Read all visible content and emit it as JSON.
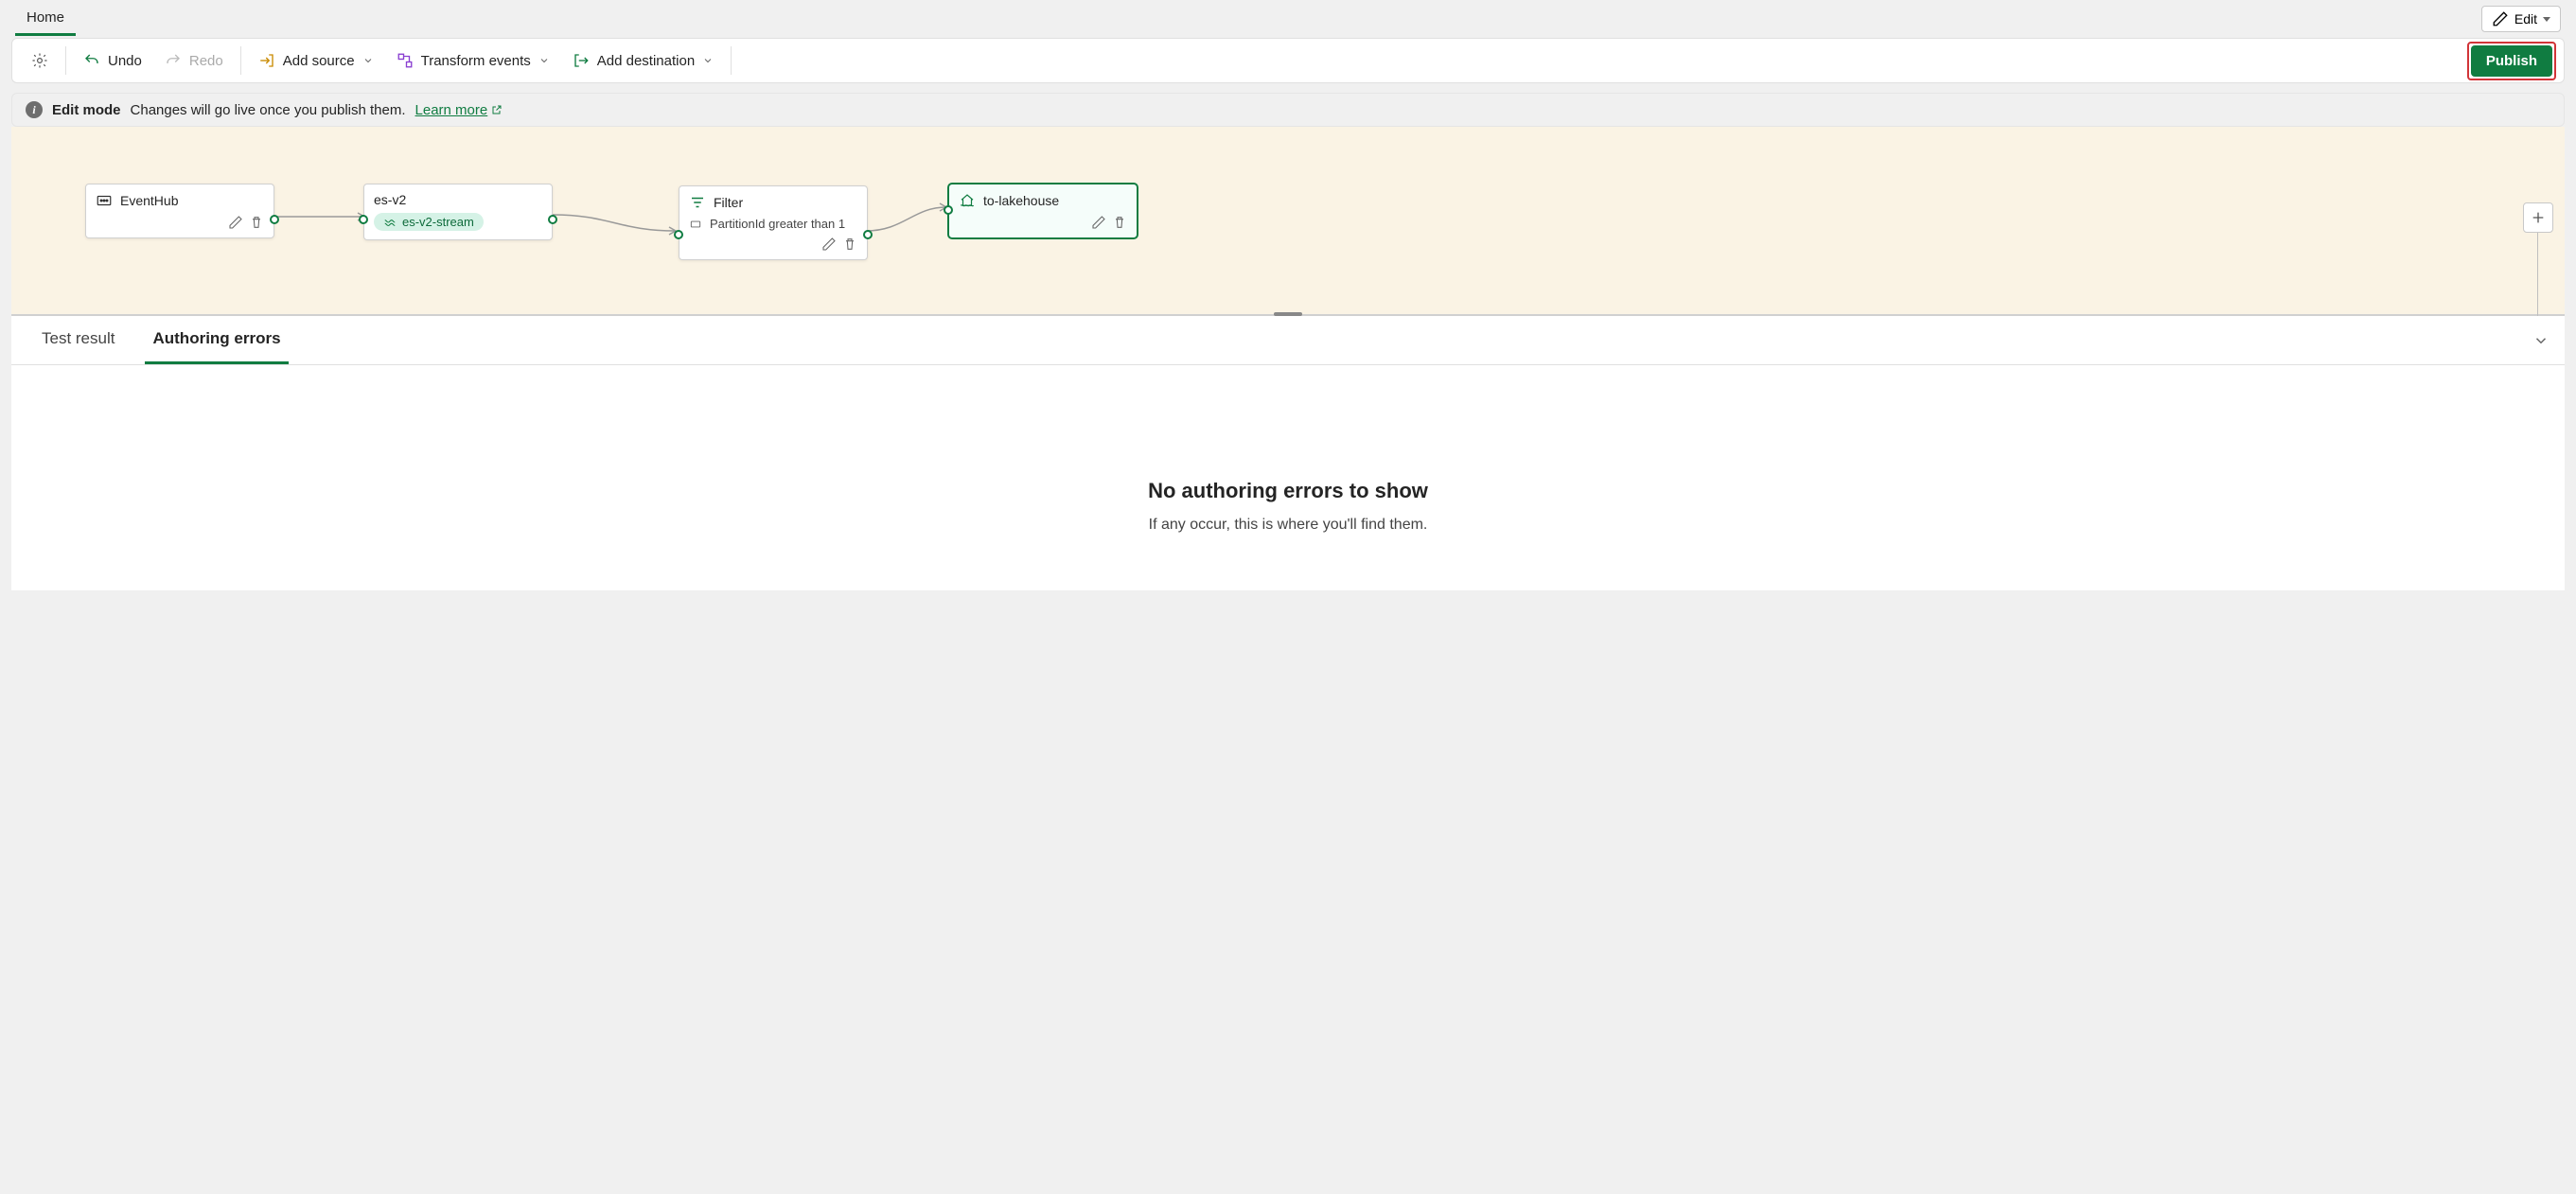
{
  "tabs": {
    "home": "Home"
  },
  "edit_button": "Edit",
  "toolbar": {
    "undo": "Undo",
    "redo": "Redo",
    "add_source": "Add source",
    "transform": "Transform events",
    "add_dest": "Add destination",
    "publish": "Publish"
  },
  "infobar": {
    "mode": "Edit mode",
    "msg": "Changes will go live once you publish them.",
    "learn_more": "Learn more"
  },
  "nodes": {
    "eventhub": {
      "title": "EventHub"
    },
    "stream": {
      "title": "es-v2",
      "chip": "es-v2-stream"
    },
    "filter": {
      "title": "Filter",
      "rule": "PartitionId greater than 1"
    },
    "dest": {
      "title": "to-lakehouse"
    }
  },
  "panel": {
    "tab_test": "Test result",
    "tab_errors": "Authoring errors",
    "empty_title": "No authoring errors to show",
    "empty_sub": "If any occur, this is where you'll find them."
  }
}
